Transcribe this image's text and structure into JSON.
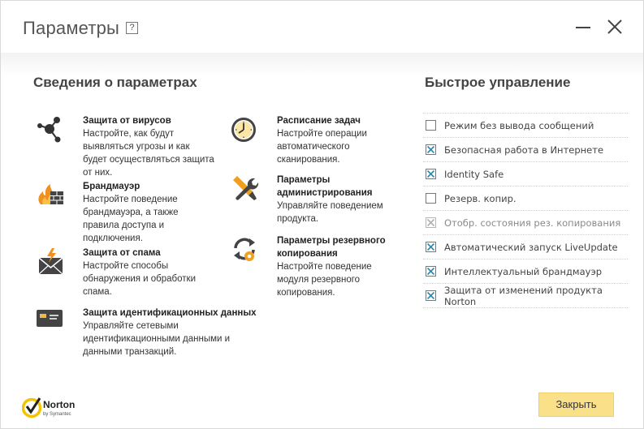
{
  "window": {
    "title": "Параметры",
    "help_label": "?"
  },
  "settings": {
    "title": "Сведения о параметрах",
    "items": [
      {
        "icon": "virus-protection-icon",
        "heading": "Защита от вирусов",
        "description": "Настройте, как будут\nвыявляться угрозы и как\nбудет осуществляться защита\nот них."
      },
      {
        "icon": "firewall-icon",
        "heading": "Брандмауэр",
        "description": "Настройте поведение\nбрандмауэра, а также\nправила доступа и\nподключения."
      },
      {
        "icon": "spam-icon",
        "heading": "Защита от спама",
        "description": "Настройте способы\nобнаружения и обработки\nспама."
      },
      {
        "icon": "identity-card-icon",
        "heading": "Защита идентификационных данных",
        "description": "Управляйте сетевыми\nидентификационными данными и\nданными транзакций."
      },
      {
        "icon": "clock-icon",
        "heading": "Расписание задач",
        "description": "Настройте операции\nавтоматического\nсканирования."
      },
      {
        "icon": "tools-icon",
        "heading": "Параметры администрирования",
        "description": "Управляйте поведением\nпродукта."
      },
      {
        "icon": "backup-icon",
        "heading": "Параметры резервного копирования",
        "description": "Настройте поведение\n модуля резервного\n копирования."
      }
    ]
  },
  "quick_controls": {
    "title": "Быстрое управление",
    "items": [
      {
        "label": "Режим без вывода сообщений",
        "checked": false,
        "disabled": false
      },
      {
        "label": "Безопасная работа в Интернете",
        "checked": true,
        "disabled": false
      },
      {
        "label": "Identity Safe",
        "checked": true,
        "disabled": false
      },
      {
        "label": "Резерв. копир.",
        "checked": false,
        "disabled": false
      },
      {
        "label": "Отобр. состояния рез. копирования",
        "checked": true,
        "disabled": true
      },
      {
        "label": "Автоматический запуск LiveUpdate",
        "checked": true,
        "disabled": false
      },
      {
        "label": "Интеллектуальный брандмауэр",
        "checked": true,
        "disabled": false
      },
      {
        "label": "Защита от изменений продукта Norton",
        "checked": true,
        "disabled": false
      }
    ]
  },
  "footer": {
    "logo_text": "Norton",
    "logo_subtext": "by Symantec",
    "close_label": "Закрыть"
  },
  "colors": {
    "accent_check": "#1a8fc2",
    "button_bg": "#fbe08a",
    "logo_yellow": "#f5c400"
  }
}
